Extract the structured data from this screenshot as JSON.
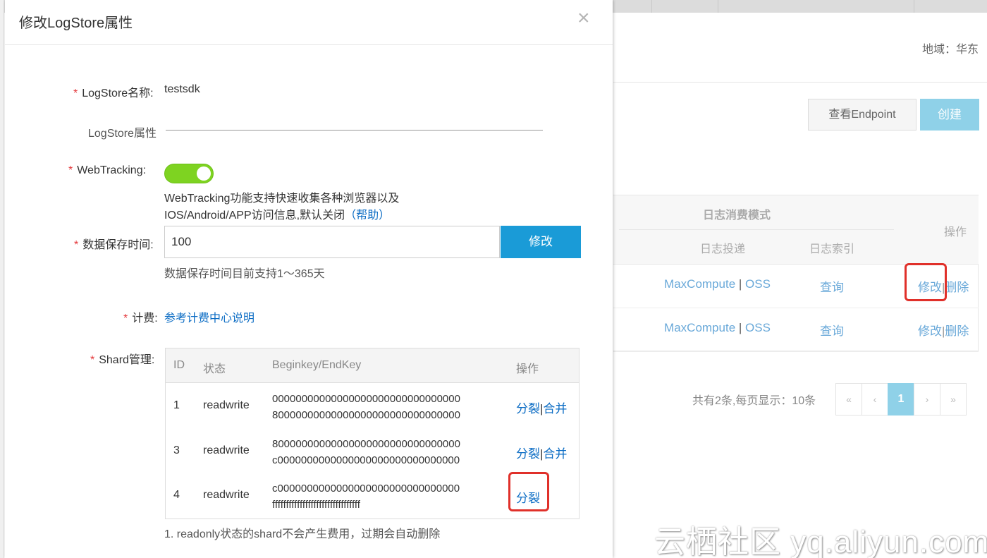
{
  "modal": {
    "title": "修改LogStore属性",
    "close_glyph": "×",
    "name_label": "LogStore名称:",
    "name_value": "testsdk",
    "section_title": "LogStore属性",
    "webtracking_label": "WebTracking:",
    "webtracking_enabled": true,
    "webtracking_help_line1": "WebTracking功能支持快速收集各种浏览器以及",
    "webtracking_help_line2": "IOS/Android/APP访问信息,默认关闭",
    "webtracking_help_link": "（帮助）",
    "retention_label": "数据保存时间:",
    "retention_value": "100",
    "modify_button": "修改",
    "retention_hint": "数据保存时间目前支持1～365天",
    "billing_label": "计费:",
    "billing_link": "参考计费中心说明",
    "shard_label": "Shard管理:",
    "required_mark": "*",
    "shard_table": {
      "headers": {
        "id": "ID",
        "state": "状态",
        "key": "Beginkey/EndKey",
        "ops": "操作"
      },
      "rows": [
        {
          "id": "1",
          "state": "readwrite",
          "begin": "00000000000000000000000000000000",
          "end": "80000000000000000000000000000000",
          "split": "分裂",
          "bar": "|",
          "merge": "合并"
        },
        {
          "id": "3",
          "state": "readwrite",
          "begin": "80000000000000000000000000000000",
          "end": "c0000000000000000000000000000000",
          "split": "分裂",
          "bar": "|",
          "merge": "合并"
        },
        {
          "id": "4",
          "state": "readwrite",
          "begin": "c0000000000000000000000000000000",
          "end": "ffffffffffffffffffffffffffffffff",
          "split": "分裂"
        }
      ]
    },
    "shard_note": "1. readonly状态的shard不会产生费用，过期会自动删除"
  },
  "background": {
    "region_label": "地域：华东",
    "endpoint_button": "查看Endpoint",
    "create_button": "创建",
    "table": {
      "group_header": "日志消费模式",
      "col_ship": "日志投递",
      "col_index": "日志索引",
      "col_ops": "操作",
      "rows": [
        {
          "ship_a": "MaxCompute",
          "bar": "|",
          "ship_b": "OSS",
          "query": "查询",
          "modify": "修改",
          "op_bar": "|",
          "delete": "删除"
        },
        {
          "ship_a": "MaxCompute",
          "bar": "|",
          "ship_b": "OSS",
          "query": "查询",
          "modify": "修改",
          "op_bar": "|",
          "delete": "删除"
        }
      ]
    },
    "pagination": {
      "info": "共有2条,每页显示：10条",
      "first": "«",
      "prev": "‹",
      "current": "1",
      "next": "›",
      "last": "»"
    },
    "watermark": "云栖社区 yq.aliyun.com"
  },
  "colors": {
    "accent": "#1a9bd7",
    "create_button": "#8fd1e8",
    "toggle_on": "#7ed321",
    "highlight_box": "#e0302a",
    "link": "#0b6cc4",
    "required": "#e4393c"
  }
}
